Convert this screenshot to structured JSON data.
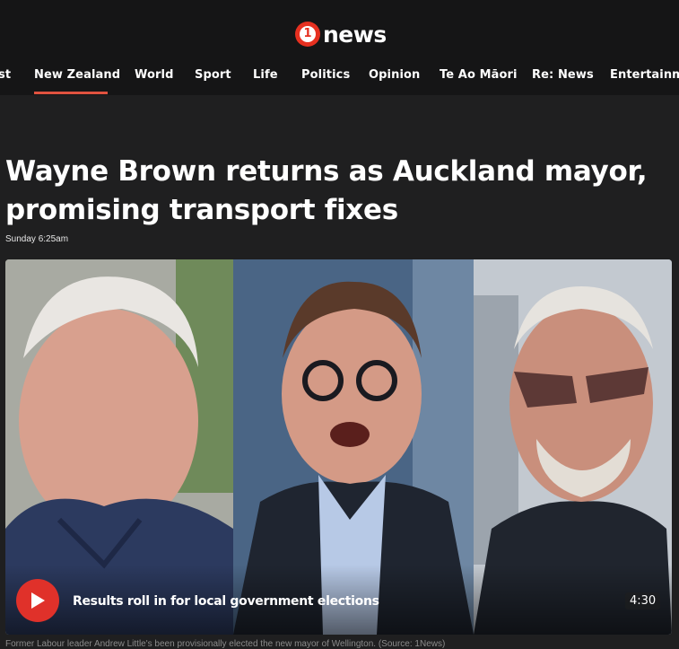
{
  "brand": {
    "logo_mark": "1",
    "logo_word": "news"
  },
  "nav": {
    "items": [
      {
        "label": "st",
        "active": false
      },
      {
        "label": "New Zealand",
        "active": true
      },
      {
        "label": "World",
        "active": false
      },
      {
        "label": "Sport",
        "active": false
      },
      {
        "label": "Life",
        "active": false
      },
      {
        "label": "Politics",
        "active": false
      },
      {
        "label": "Opinion",
        "active": false
      },
      {
        "label": "Te Ao Māori",
        "active": false
      },
      {
        "label": "Re: News",
        "active": false
      },
      {
        "label": "Entertainme",
        "active": false
      }
    ],
    "accent_color": "#e0523f"
  },
  "article": {
    "headline": "Wayne Brown returns as Auckland mayor, promising transport fixes",
    "timestamp": "Sunday 6:25am"
  },
  "video": {
    "title": "Results roll in for local government elections",
    "duration": "4:30",
    "play_icon": "play-icon",
    "caption": "Former Labour leader Andrew Little's been provisionally elected the new mayor of Wellington. (Source: 1News)"
  },
  "colors": {
    "play_button": "#e0312a",
    "page_background": "#1f1f20",
    "header_background": "#151516"
  }
}
